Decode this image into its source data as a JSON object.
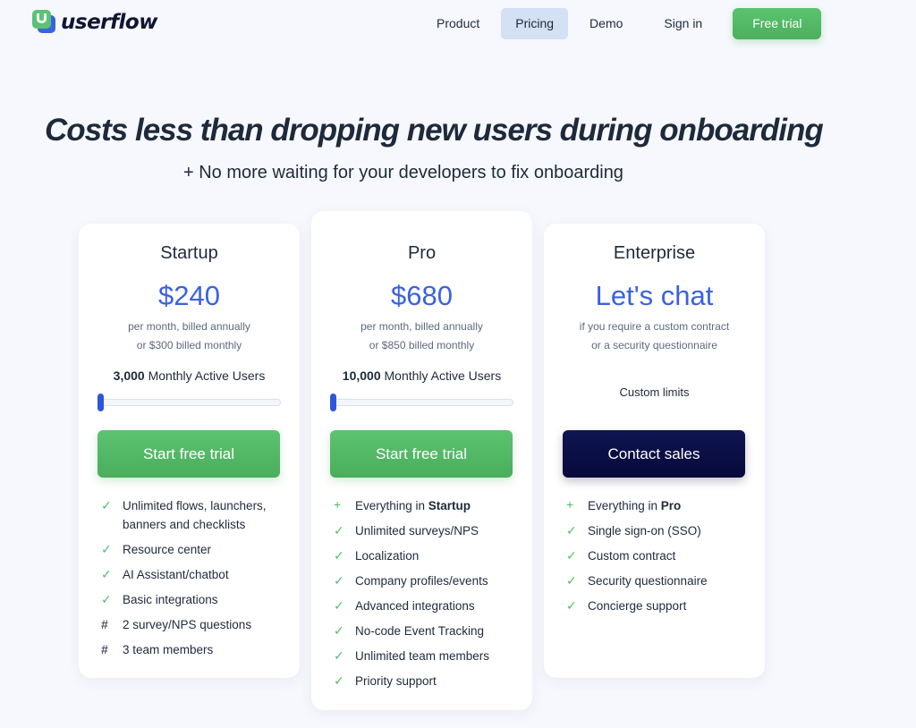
{
  "nav": {
    "logo_text": "userflow",
    "links": [
      {
        "label": "Product"
      },
      {
        "label": "Pricing",
        "active": true
      },
      {
        "label": "Demo"
      },
      {
        "label": "Sign in"
      }
    ],
    "cta_label": "Free trial"
  },
  "hero": {
    "title": "Costs less than dropping new users during onboarding",
    "subtitle": "+ No more waiting for your developers to fix onboarding"
  },
  "plans": [
    {
      "name": "Startup",
      "price": "$240",
      "note_line1": "per month, billed annually",
      "note_line2": "or $300 billed monthly",
      "mau_count": "3,000",
      "mau_label": " Monthly Active Users",
      "slider_value_fraction": 0,
      "button_label": "Start free trial",
      "features": [
        {
          "icon": "check-icon",
          "text": "Unlimited flows, launchers, banners and checklists"
        },
        {
          "icon": "check-icon",
          "text": "Resource center"
        },
        {
          "icon": "check-icon",
          "text": "AI Assistant/chatbot"
        },
        {
          "icon": "check-icon",
          "text": "Basic integrations"
        },
        {
          "icon": "hash-icon",
          "text": "2 survey/NPS questions"
        },
        {
          "icon": "hash-icon",
          "text": "3 team members"
        }
      ]
    },
    {
      "name": "Pro",
      "price": "$680",
      "note_line1": "per month, billed annually",
      "note_line2": "or $850 billed monthly",
      "mau_count": "10,000",
      "mau_label": " Monthly Active Users",
      "slider_value_fraction": 0,
      "button_label": "Start free trial",
      "features": [
        {
          "icon": "plus-icon",
          "prefix": "Everything in ",
          "bold": "Startup"
        },
        {
          "icon": "check-icon",
          "text": "Unlimited surveys/NPS"
        },
        {
          "icon": "check-icon",
          "text": "Localization"
        },
        {
          "icon": "check-icon",
          "text": "Company profiles/events"
        },
        {
          "icon": "check-icon",
          "text": "Advanced integrations"
        },
        {
          "icon": "check-icon",
          "text": "No-code Event Tracking"
        },
        {
          "icon": "check-icon",
          "text": "Unlimited team members"
        },
        {
          "icon": "check-icon",
          "text": "Priority support"
        }
      ]
    },
    {
      "name": "Enterprise",
      "price": "Let's chat",
      "note_line1": "if you require a custom contract",
      "note_line2": "or a security questionnaire",
      "custom_limits": "Custom limits",
      "button_label": "Contact sales",
      "features": [
        {
          "icon": "plus-icon",
          "prefix": "Everything in ",
          "bold": "Pro"
        },
        {
          "icon": "check-icon",
          "text": "Single sign-on (SSO)"
        },
        {
          "icon": "check-icon",
          "text": "Custom contract"
        },
        {
          "icon": "check-icon",
          "text": "Security questionnaire"
        },
        {
          "icon": "check-icon",
          "text": "Concierge support"
        }
      ]
    }
  ],
  "icons": {
    "check-icon": "✓",
    "plus-icon": "+",
    "hash-icon": "#"
  },
  "colors": {
    "accent_blue": "#3a62e0",
    "brand_green": "#5bc374",
    "navy": "#0e1550"
  }
}
